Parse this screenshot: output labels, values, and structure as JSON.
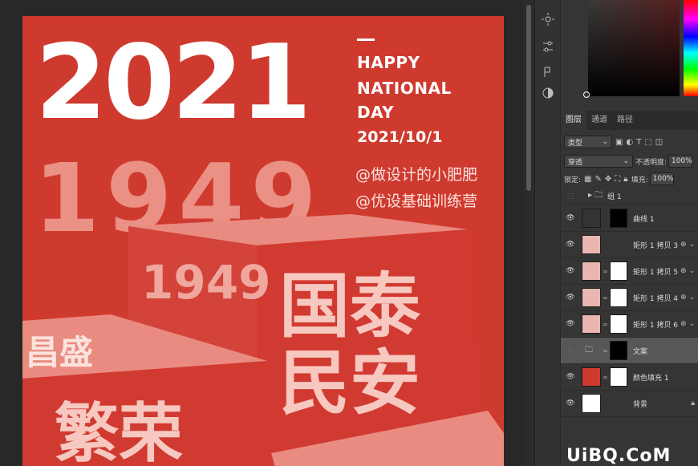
{
  "poster": {
    "year_big": "2021",
    "year_ghost": "1949",
    "tagline": [
      "HAPPY",
      "NATIONAL",
      "DAY"
    ],
    "date": "2021/10/1",
    "credits": [
      "@做设计的小肥肥",
      "@优设基础训练营"
    ],
    "cube_text": {
      "big_top": "国泰",
      "big_bottom": "民安",
      "left_front": "繁荣",
      "left_top": "昌盛",
      "box_year": "1949"
    },
    "colors": {
      "bg": "#cf3a2f",
      "cube_front": "#d3433a",
      "cube_side": "#e98b80",
      "text_pink": "#f6c8c0"
    }
  },
  "panel_tabs": [
    "图层",
    "通道",
    "路径"
  ],
  "layer_controls": {
    "filter_label": "类型",
    "blend_mode": "穿透",
    "opacity_label": "不透明度:",
    "opacity_value": "100%",
    "lock_label": "锁定:",
    "fill_label": "填充:",
    "fill_value": "100%"
  },
  "layers": [
    {
      "name": "组 1",
      "kind": "group"
    },
    {
      "name": "曲线 1",
      "kind": "adjustment"
    },
    {
      "name": "矩形 1 拷贝 3",
      "kind": "smart"
    },
    {
      "name": "矩形 1 拷贝 5",
      "kind": "masked"
    },
    {
      "name": "矩形 1 拷贝 4",
      "kind": "masked"
    },
    {
      "name": "矩形 1 拷贝 6",
      "kind": "masked"
    },
    {
      "name": "文案",
      "kind": "group-mask"
    },
    {
      "name": "颜色填充 1",
      "kind": "fill"
    },
    {
      "name": "背景",
      "kind": "background"
    }
  ],
  "icons": [
    "sun-icon",
    "sliders-icon",
    "adjust-icon",
    "contrast-icon",
    "eye-icon",
    "folder-icon",
    "chain-icon",
    "lock-icon"
  ],
  "watermark": "UiBQ.CoM"
}
